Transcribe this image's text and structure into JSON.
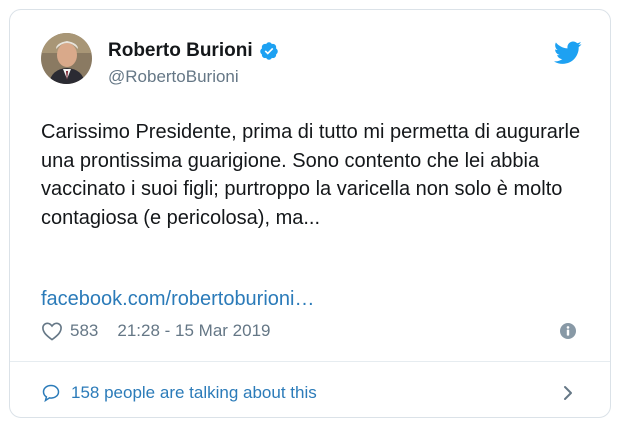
{
  "author": {
    "name": "Roberto Burioni",
    "handle": "@RobertoBurioni",
    "verified_icon": "verified-badge-icon",
    "avatar_icon": "avatar"
  },
  "brand": {
    "icon": "twitter-bird-icon",
    "color": "#1da1f2"
  },
  "tweet": {
    "text": "Carissimo Presidente, prima di tutto mi permetta di augurarle una prontissima guarigione. Sono contento che lei abbia vaccinato i suoi figli; purtroppo la varicella non solo è molto contagiosa (e pericolosa), ma...",
    "link": "facebook.com/robertoburioni…"
  },
  "meta": {
    "likes": "583",
    "timestamp": "21:28 - 15 Mar 2019",
    "heart_icon": "heart-icon",
    "info_icon": "info-icon"
  },
  "footer": {
    "talking_text": "158 people are talking about this",
    "bubble_icon": "speech-bubble-icon",
    "chevron_icon": "chevron-right-icon"
  },
  "colors": {
    "text": "#14171a",
    "secondary": "#657786",
    "link": "#2b7bb9",
    "border": "#dbe2e8"
  }
}
